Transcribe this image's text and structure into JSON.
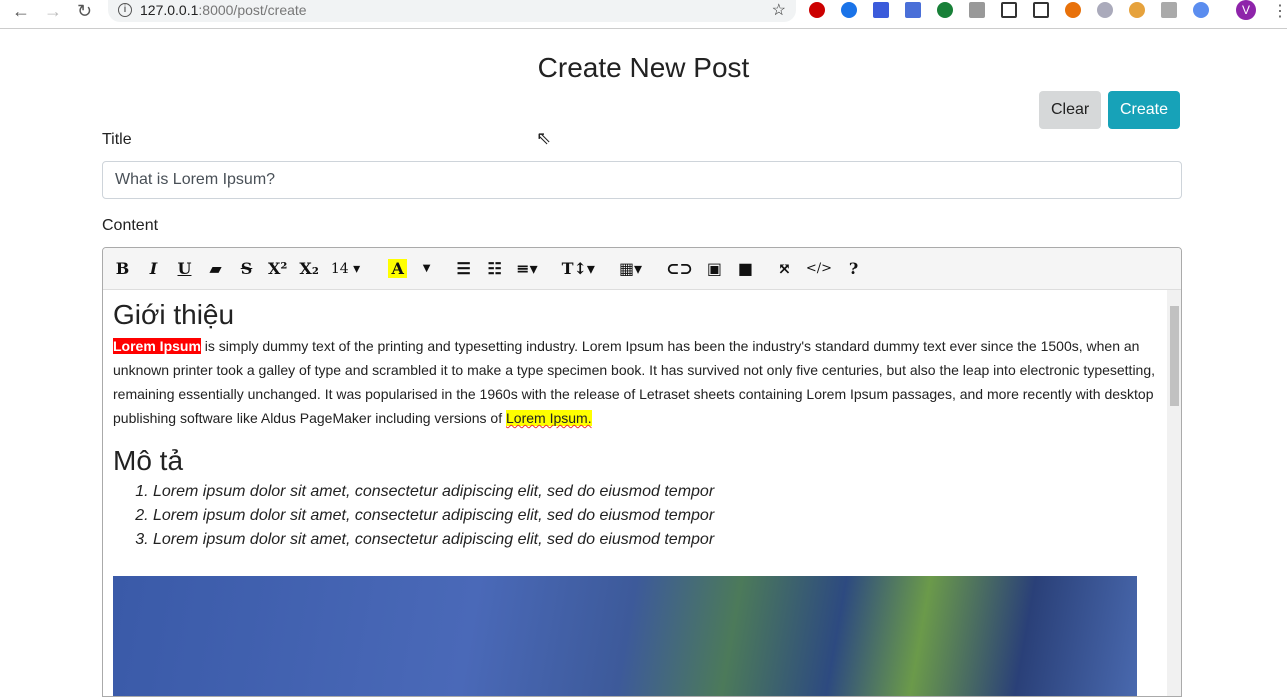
{
  "browser": {
    "url_host": "127.0.0.1",
    "url_path": ":8000/post/create",
    "avatar": "V"
  },
  "page": {
    "title": "Create New Post",
    "clear_label": "Clear",
    "create_label": "Create"
  },
  "form": {
    "title_label": "Title",
    "title_value": "What is Lorem Ipsum?",
    "content_label": "Content"
  },
  "toolbar": {
    "bold": "B",
    "italic": "I",
    "underline": "U",
    "strike": "S",
    "sup": "X²",
    "sub": "X₂",
    "font_size": "14",
    "color": "A",
    "help": "?",
    "code": "</>"
  },
  "content": {
    "heading1": "Giới thiệu",
    "p_hl1": "Lorem Ipsum",
    "p_body": " is simply dummy text of the printing and typesetting industry. Lorem Ipsum has been the industry's standard dummy text ever since the 1500s, when an unknown printer took a galley of type and scrambled it to make a type specimen book. It has survived not only five centuries, but also the leap into electronic typesetting, remaining essentially unchanged. It was popularised in the 1960s with the release of Letraset sheets containing Lorem Ipsum passages, and more recently with desktop publishing software like Aldus PageMaker including versions of ",
    "p_hl2": "Lorem Ipsum.",
    "heading2": "Mô tả",
    "list": [
      "Lorem ipsum dolor sit amet, consectetur adipiscing elit, sed do eiusmod tempor",
      "Lorem ipsum dolor sit amet, consectetur adipiscing elit, sed do eiusmod tempor",
      "Lorem ipsum dolor sit amet, consectetur adipiscing elit, sed do eiusmod tempor"
    ]
  },
  "colors": {
    "primary": "#17a2b8",
    "secondary": "#d6d8d9",
    "highlight_red": "#ff0000",
    "highlight_yellow": "#ffff00"
  }
}
